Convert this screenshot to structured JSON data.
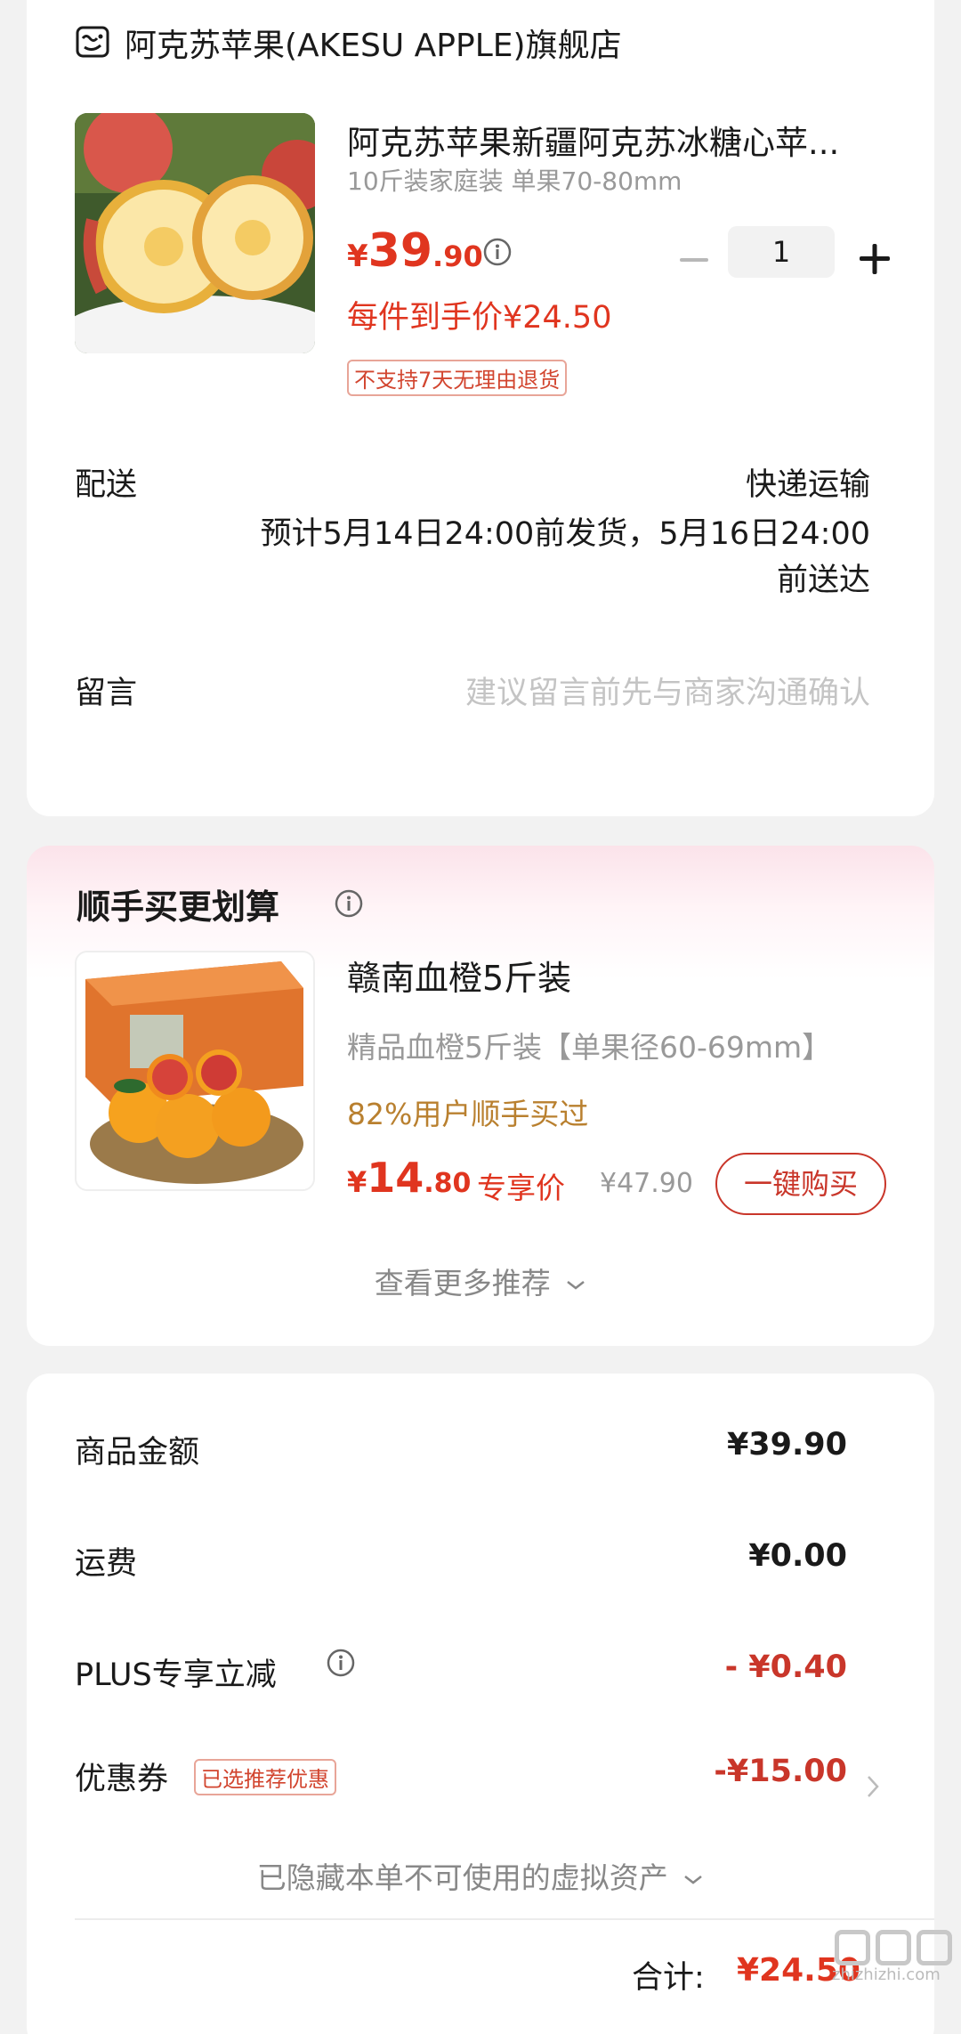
{
  "store": {
    "name": "阿克苏苹果(AKESU APPLE)旗舰店",
    "product": {
      "title": "阿克苏苹果新疆阿克苏冰糖心苹...",
      "spec": "10斤装家庭装 单果70-80mm",
      "price_currency": "¥",
      "price_int": "39",
      "price_dec": ".90",
      "unit_price": "每件到手价¥24.50",
      "quantity": "1",
      "return_tag": "不支持7天无理由退货"
    },
    "delivery": {
      "label": "配送",
      "method": "快递运输",
      "time_line1": "预计5月14日24:00前发货，5月16日24:00",
      "time_line2": "前送达"
    },
    "message": {
      "label": "留言",
      "placeholder": "建议留言前先与商家沟通确认"
    }
  },
  "recommend": {
    "title": "顺手买更划算",
    "item": {
      "name": "赣南血橙5斤装",
      "spec": "精品血橙5斤装【单果径60-69mm】",
      "bought": "82%用户顺手买过",
      "price_currency": "¥",
      "price_int": "14",
      "price_dec": ".80",
      "exclusive": "专享价",
      "orig_price": "¥47.90",
      "buy_label": "一键购买"
    },
    "more": "查看更多推荐"
  },
  "summary": {
    "goods_label": "商品金额",
    "goods_value": "¥39.90",
    "shipping_label": "运费",
    "shipping_value": "¥0.00",
    "plus_label": "PLUS专享立减",
    "plus_value": "- ¥0.40",
    "coupon_label": "优惠券",
    "coupon_tag": "已选推荐优惠",
    "coupon_value": "-¥15.00",
    "hidden_assets": "已隐藏本单不可使用的虚拟资产",
    "total_label": "合计:",
    "total_value": "¥24.50"
  },
  "watermark": "zhizhizhi.com",
  "colors": {
    "price_red": "#e0351f",
    "discount_red": "#c9362a",
    "bought_gold": "#b9802f",
    "page_bg": "#f2f2f2"
  },
  "icons": [
    "store-icon",
    "info-icon",
    "minus-icon",
    "plus-icon",
    "chevron-down-icon",
    "chevron-right-icon"
  ]
}
